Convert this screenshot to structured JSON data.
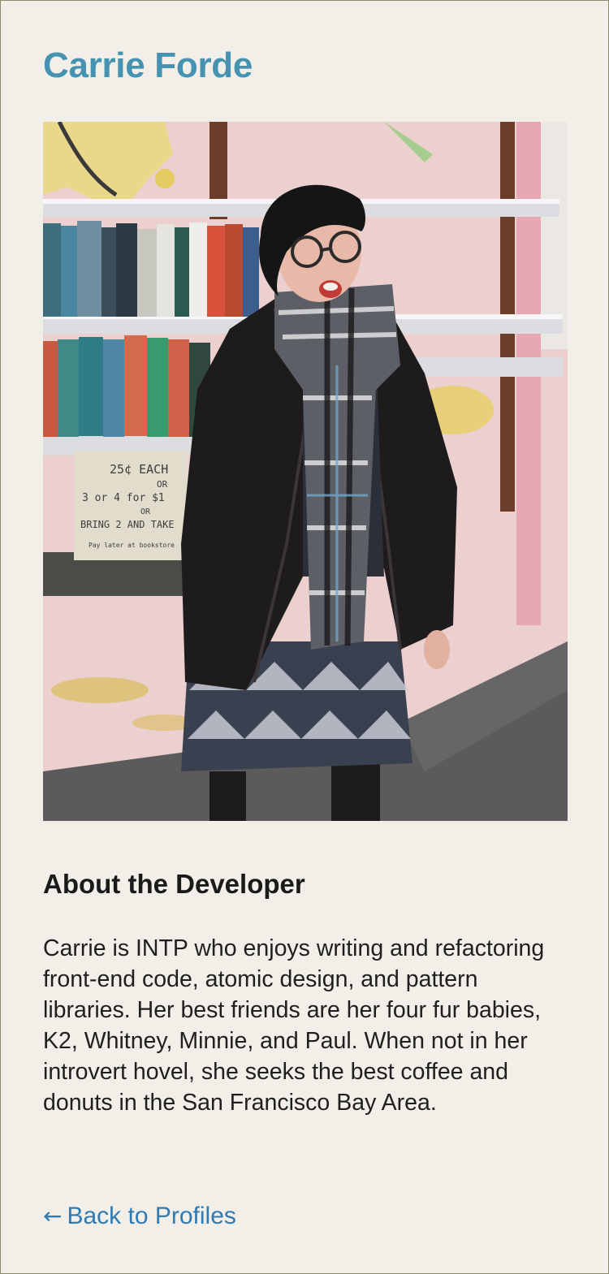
{
  "profile": {
    "name": "Carrie Forde",
    "photo_alt": "Carrie Forde",
    "about_heading": "About the Developer",
    "bio": "Carrie is INTP who enjoys writing and refactoring front-end code, atomic design, and pattern libraries. Her best friends are her four fur babies, K2, Whitney, Minnie, and Paul. When not in her introvert hovel, she seeks the best coffee and donuts in the San Francisco Bay Area."
  },
  "photo_text": {
    "sign_line1": "25¢ EACH",
    "sign_line2": "OR",
    "sign_line3": "3 or 4 for $1",
    "sign_line4": "OR",
    "sign_line5": "BRING 2 AND TAKE",
    "sign_line6": "Pay later at bookstore"
  },
  "nav": {
    "back_arrow": "←",
    "back_label": "Back to Profiles"
  },
  "colors": {
    "background": "#f2eee8",
    "name": "#4592b1",
    "link": "#2f7bb2",
    "text": "#1f1f1f",
    "border": "#8b8b6e"
  }
}
